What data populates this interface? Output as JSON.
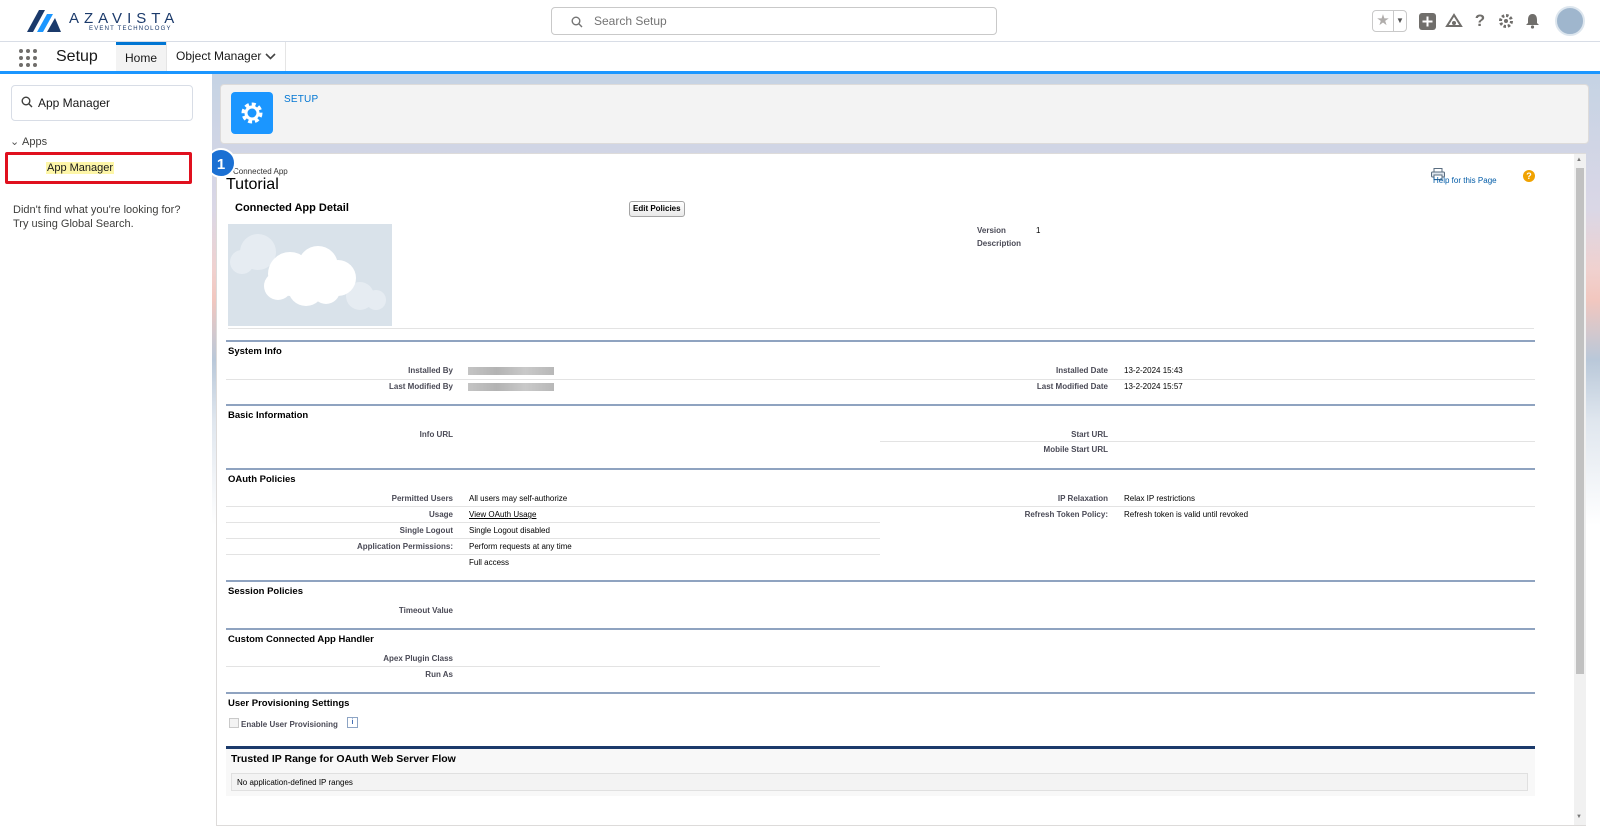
{
  "header": {
    "brand": "AZAVISTA",
    "brand_tagline": "EVENT TECHNOLOGY",
    "search_placeholder": "Search Setup"
  },
  "nav": {
    "app_name": "Setup",
    "tabs": [
      {
        "label": "Home"
      },
      {
        "label": "Object Manager"
      }
    ]
  },
  "sidebar": {
    "search_value": "App Manager",
    "group_label": "Apps",
    "item_label": "App Manager",
    "not_found_line1": "Didn't find what you're looking for?",
    "not_found_line2": "Try using Global Search."
  },
  "page_header": {
    "label": "SETUP"
  },
  "step_badge": "1",
  "content": {
    "page_type": "Connected App",
    "title": "Tutorial",
    "help_link": "Help for this Page",
    "help_icon": "?",
    "detail_title": "Connected App Detail",
    "edit_policies": "Edit Policies",
    "version_label": "Version",
    "version_value": "1",
    "description_label": "Description"
  },
  "system_info": {
    "title": "System Info",
    "installed_by_label": "Installed By",
    "last_modified_by_label": "Last Modified By",
    "installed_date_label": "Installed Date",
    "installed_date_value": "13-2-2024 15:43",
    "last_modified_date_label": "Last Modified Date",
    "last_modified_date_value": "13-2-2024 15:57"
  },
  "basic_info": {
    "title": "Basic Information",
    "info_url_label": "Info URL",
    "start_url_label": "Start URL",
    "mobile_start_url_label": "Mobile Start URL"
  },
  "oauth": {
    "title": "OAuth Policies",
    "permitted_users_label": "Permitted Users",
    "permitted_users_value": "All users may self-authorize",
    "usage_label": "Usage",
    "usage_value": "View OAuth Usage",
    "single_logout_label": "Single Logout",
    "single_logout_value": "Single Logout disabled",
    "app_permissions_label": "Application Permissions:",
    "app_permissions_value1": "Perform requests at any time",
    "app_permissions_value2": "Full access",
    "ip_relaxation_label": "IP Relaxation",
    "ip_relaxation_value": "Relax IP restrictions",
    "refresh_label": "Refresh Token Policy:",
    "refresh_value": "Refresh token is valid until revoked"
  },
  "session": {
    "title": "Session Policies",
    "timeout_label": "Timeout Value"
  },
  "handler": {
    "title": "Custom Connected App Handler",
    "apex_label": "Apex Plugin Class",
    "run_as_label": "Run As"
  },
  "provisioning": {
    "title": "User Provisioning Settings",
    "enable_label": "Enable User Provisioning",
    "info_icon": "i"
  },
  "trusted": {
    "title": "Trusted IP Range for OAuth Web Server Flow",
    "empty_text": "No application-defined IP ranges"
  },
  "colors": {
    "accent": "#0176d3",
    "setup_icon_bg": "#1b96ff",
    "highlight_border": "#e0101e",
    "highlight_text_bg": "#fdf6a8",
    "section_rule": "#8fa3c0"
  }
}
